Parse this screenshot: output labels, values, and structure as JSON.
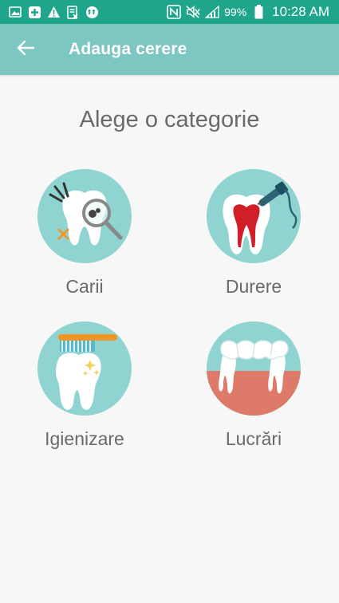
{
  "status_bar": {
    "battery": "99%",
    "time": "10:28 AM",
    "icons": [
      "image-icon",
      "plus-icon",
      "warning-icon",
      "data-icon",
      "tt-icon",
      "nfc-icon",
      "mute-icon",
      "signal-icon",
      "battery-icon"
    ]
  },
  "app_bar": {
    "title": "Adauga cerere",
    "back_icon": "arrow-left-icon"
  },
  "main": {
    "heading": "Alege o categorie",
    "categories": [
      {
        "label": "Carii",
        "icon": "tooth-cavity-icon"
      },
      {
        "label": "Durere",
        "icon": "tooth-pain-icon"
      },
      {
        "label": "Igienizare",
        "icon": "tooth-brush-icon"
      },
      {
        "label": "Lucrări",
        "icon": "dental-bridge-icon"
      }
    ]
  },
  "colors": {
    "status_bar": "#1fa58b",
    "app_bar": "#7cc7c1",
    "circle": "#8fd4d0",
    "text": "#6a6a6a"
  }
}
